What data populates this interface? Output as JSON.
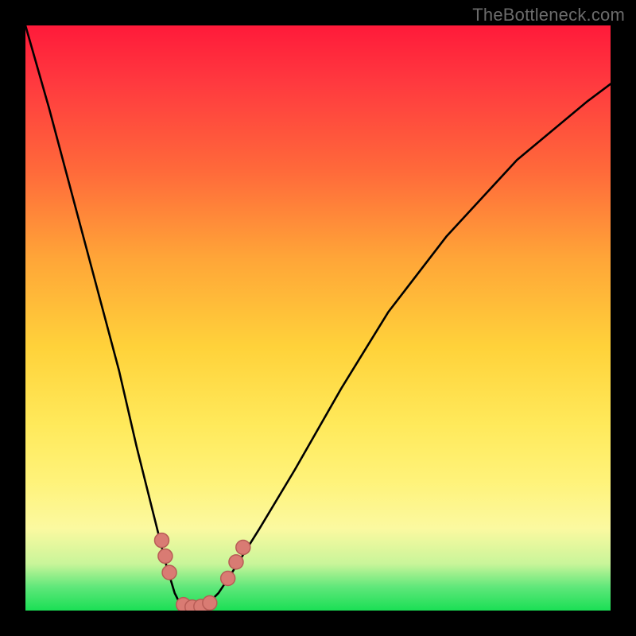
{
  "watermark": "TheBottleneck.com",
  "chart_data": {
    "type": "line",
    "title": "",
    "xlabel": "",
    "ylabel": "",
    "xlim": [
      0,
      100
    ],
    "ylim": [
      0,
      100
    ],
    "background_gradient": {
      "top_color": "#ff1a3a",
      "mid_colors": [
        "#ff6a3a",
        "#ffd23a",
        "#fff37a"
      ],
      "bottom_color": "#1adf55",
      "meaning": "red = high bottleneck, green = low bottleneck"
    },
    "series": [
      {
        "name": "bottleneck-curve",
        "x": [
          0,
          4,
          8,
          12,
          16,
          19,
          22,
          24,
          25.5,
          26.5,
          28,
          29.5,
          31,
          33,
          35,
          40,
          46,
          54,
          62,
          72,
          84,
          96,
          100
        ],
        "y": [
          100,
          86,
          71,
          56,
          41,
          28,
          16,
          8,
          3,
          1,
          0.5,
          0.6,
          1,
          3,
          6,
          14,
          24,
          38,
          51,
          64,
          77,
          87,
          90
        ]
      }
    ],
    "markers": [
      {
        "name": "marker-left-branch-upper",
        "x": 23.3,
        "y": 12.0
      },
      {
        "name": "marker-left-branch-mid",
        "x": 23.9,
        "y": 9.3
      },
      {
        "name": "marker-left-branch-lower",
        "x": 24.6,
        "y": 6.5
      },
      {
        "name": "marker-trough-left",
        "x": 27.0,
        "y": 1.0
      },
      {
        "name": "marker-trough-a",
        "x": 28.5,
        "y": 0.6
      },
      {
        "name": "marker-trough-b",
        "x": 30.0,
        "y": 0.7
      },
      {
        "name": "marker-trough-right",
        "x": 31.5,
        "y": 1.3
      },
      {
        "name": "marker-right-branch-lower",
        "x": 34.6,
        "y": 5.5
      },
      {
        "name": "marker-right-branch-mid",
        "x": 36.0,
        "y": 8.3
      },
      {
        "name": "marker-right-branch-upper",
        "x": 37.2,
        "y": 10.8
      }
    ],
    "marker_style": {
      "fill": "#d97b73",
      "stroke": "#b85c56",
      "radius_px": 9
    },
    "notes": "No numeric axes shown; x/y given on 0–100 normalized scale where y=0 is bottom (green) and y=100 is top (red). Dip near x≈29 reaches the green band."
  }
}
